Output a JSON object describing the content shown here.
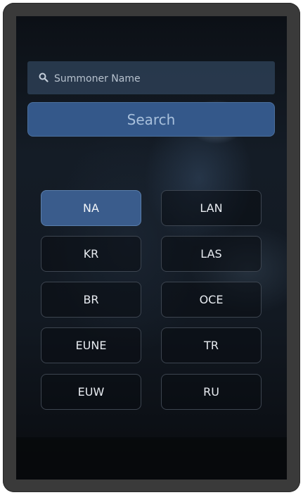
{
  "search": {
    "placeholder": "Summoner Name",
    "button_label": "Search",
    "icon": "search-icon"
  },
  "regions": [
    {
      "label": "NA",
      "selected": true
    },
    {
      "label": "LAN",
      "selected": false
    },
    {
      "label": "KR",
      "selected": false
    },
    {
      "label": "LAS",
      "selected": false
    },
    {
      "label": "BR",
      "selected": false
    },
    {
      "label": "OCE",
      "selected": false
    },
    {
      "label": "EUNE",
      "selected": false
    },
    {
      "label": "TR",
      "selected": false
    },
    {
      "label": "EUW",
      "selected": false
    },
    {
      "label": "RU",
      "selected": false
    }
  ],
  "colors": {
    "accent": "#34588a",
    "selected_region": "#3a5c8c",
    "device_frame": "#3a3a3a"
  }
}
